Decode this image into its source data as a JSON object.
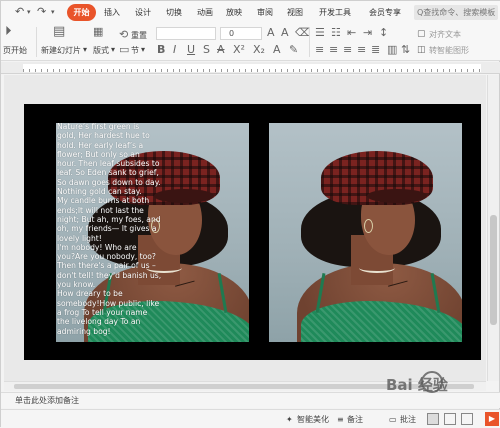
{
  "quick_access": {
    "undo_label": "↶",
    "redo_label": "↷"
  },
  "tabs": [
    {
      "label": "开始",
      "active": true
    },
    {
      "label": "插入",
      "active": false
    },
    {
      "label": "设计",
      "active": false
    },
    {
      "label": "切换",
      "active": false
    },
    {
      "label": "动画",
      "active": false
    },
    {
      "label": "放映",
      "active": false
    },
    {
      "label": "审阅",
      "active": false
    },
    {
      "label": "视图",
      "active": false
    },
    {
      "label": "开发工具",
      "active": false
    },
    {
      "label": "会员专享",
      "active": false
    }
  ],
  "search": {
    "placeholder": "Q查找命令、搜索模板"
  },
  "ribbon": {
    "play_from_start": "页开始",
    "new_slide": "新建幻灯片",
    "layout": "版式",
    "section": "节",
    "reset": "重置",
    "font_size": "0",
    "text_box": "对齐文本",
    "smart_shape": "转智能图形"
  },
  "slide": {
    "poem_lines": [
      "Nature’s first green is",
      "gold, Her hardest hue to",
      "hold.  Her early leaf’s a",
      "flower; But only so an",
      "hour.  Then leaf subsides to",
      "leaf. So Eden sank to grief,",
      "So dawn goes down to day.",
      "Nothing gold can stay.",
      "My candle burns at both",
      "ends;It will not last the",
      "night; But ah, my foes, and",
      "oh, my friends— It gives a",
      "lovely light!",
      "I'm nobody! Who are",
      "you?Are you nobody, too?",
      "Then there's a pair of us –",
      "don't tell! they'd banish us,",
      "you know.",
      "How dreary to be",
      "somebody!How public, like",
      "a frog To tell your name",
      "the livelong day To an",
      "admiring bog!"
    ]
  },
  "notes": {
    "placeholder": "单击此处添加备注"
  },
  "status": {
    "smart_beautify": "智能美化",
    "notes_label": "备注",
    "comments_label": "批注",
    "play_label": "▶"
  },
  "watermark": {
    "text": "Bai 经验"
  }
}
